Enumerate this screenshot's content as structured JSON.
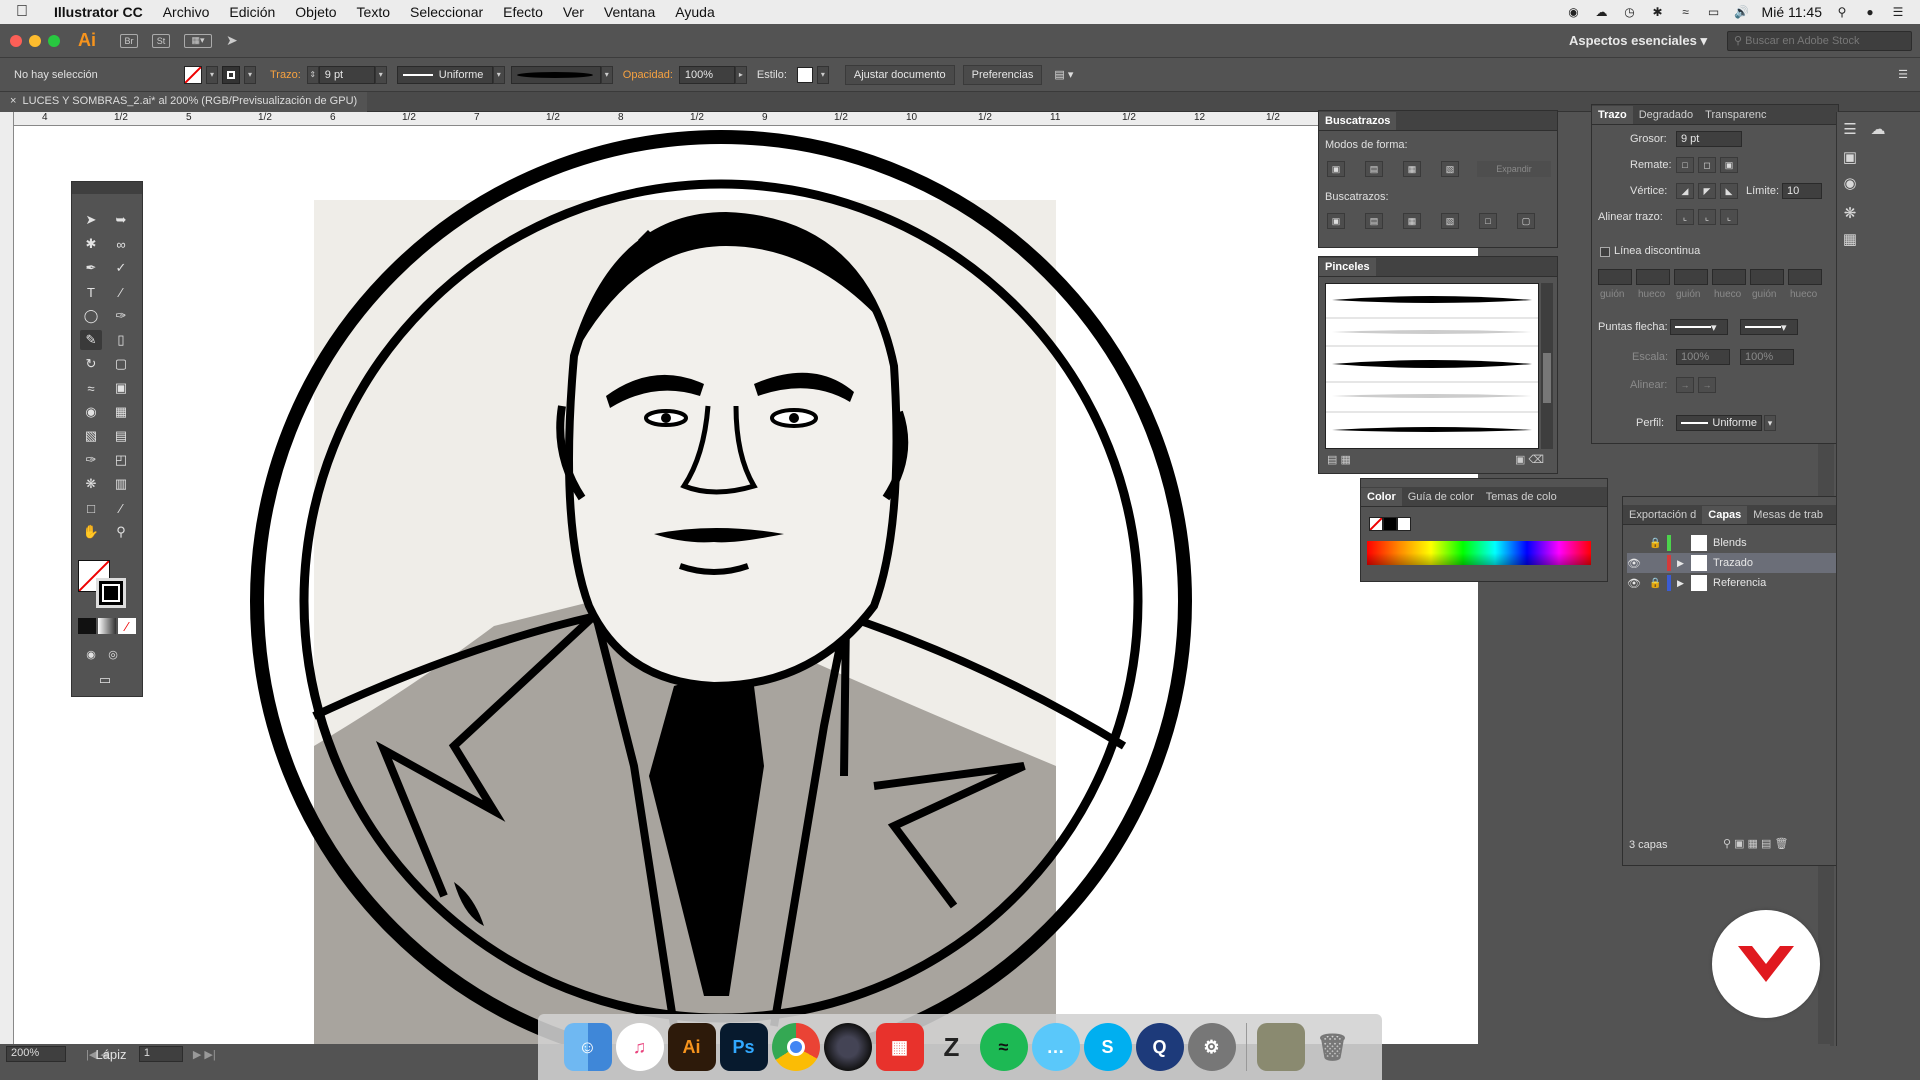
{
  "menubar": {
    "app_name": "Illustrator CC",
    "items": [
      "Archivo",
      "Edición",
      "Objeto",
      "Texto",
      "Seleccionar",
      "Efecto",
      "Ver",
      "Ventana",
      "Ayuda"
    ],
    "clock": "Mié 11:45"
  },
  "appbar": {
    "logo": "Ai",
    "bridge": "Br",
    "stock": "St",
    "workspace": "Aspectos esenciales",
    "stock_search_placeholder": "Buscar en Adobe Stock"
  },
  "controlbar": {
    "selection": "No hay selección",
    "stroke_label": "Trazo:",
    "stroke_value": "9 pt",
    "profile": "Uniforme",
    "opacity_label": "Opacidad:",
    "opacity_value": "100%",
    "style_label": "Estilo:",
    "fit_doc": "Ajustar documento",
    "prefs": "Preferencias"
  },
  "document": {
    "tab_title": "LUCES Y SOMBRAS_2.ai* al 200% (RGB/Previsualización de GPU)",
    "ruler_marks": [
      "4",
      "1/2",
      "5",
      "1/2",
      "6",
      "1/2",
      "7",
      "1/2",
      "8",
      "1/2",
      "9",
      "1/2",
      "10",
      "1/2",
      "11",
      "1/2",
      "12",
      "1/2"
    ]
  },
  "statusbar": {
    "zoom": "200%",
    "page": "1",
    "tool": "Lápiz"
  },
  "pathfinder": {
    "title": "Buscatrazos",
    "shape_modes": "Modos de forma:",
    "expand": "Expandir",
    "pathfinders": "Buscatrazos:"
  },
  "brushes": {
    "title": "Pinceles"
  },
  "color": {
    "tabs": [
      "Color",
      "Guía de color",
      "Temas de colo"
    ]
  },
  "stroke": {
    "tabs": [
      "Trazo",
      "Degradado",
      "Transparenc"
    ],
    "weight_label": "Grosor:",
    "weight_value": "9 pt",
    "cap_label": "Remate:",
    "corner_label": "Vértice:",
    "limit_label": "Límite:",
    "limit_value": "10",
    "align_label": "Alinear trazo:",
    "dashed_label": "Línea discontinua",
    "dash_labels": [
      "guión",
      "hueco",
      "guión",
      "hueco",
      "guión",
      "hueco"
    ],
    "arrowheads_label": "Puntas flecha:",
    "scale_label": "Escala:",
    "scale_value_1": "100%",
    "scale_value_2": "100%",
    "align_arrows_label": "Alinear:",
    "profile_label": "Perfil:",
    "profile_value": "Uniforme"
  },
  "layers": {
    "tabs": [
      "Exportación d",
      "Capas",
      "Mesas de trab"
    ],
    "rows": [
      {
        "name": "Blends",
        "color": "#4cd34c"
      },
      {
        "name": "Trazado",
        "color": "#d33b3b"
      },
      {
        "name": "Referencia",
        "color": "#3b5cd3"
      }
    ],
    "count": "3 capas"
  },
  "dock": {
    "apps": [
      "finder-icon",
      "itunes-icon",
      "illustrator-icon",
      "photoshop-icon",
      "chrome-icon",
      "cinema4d-icon",
      "sketchup-icon",
      "zbrush-icon",
      "spotify-icon",
      "messages-icon",
      "skype-icon",
      "quicktime-icon",
      "system-preferences-icon",
      "photo-icon",
      "trash-icon"
    ],
    "illustrator_label": "Ai",
    "photoshop_label": "Ps"
  },
  "colors": {
    "accent_orange": "#f7941d",
    "ui_bg": "#535353",
    "selected_layer": "#6b6e78"
  }
}
